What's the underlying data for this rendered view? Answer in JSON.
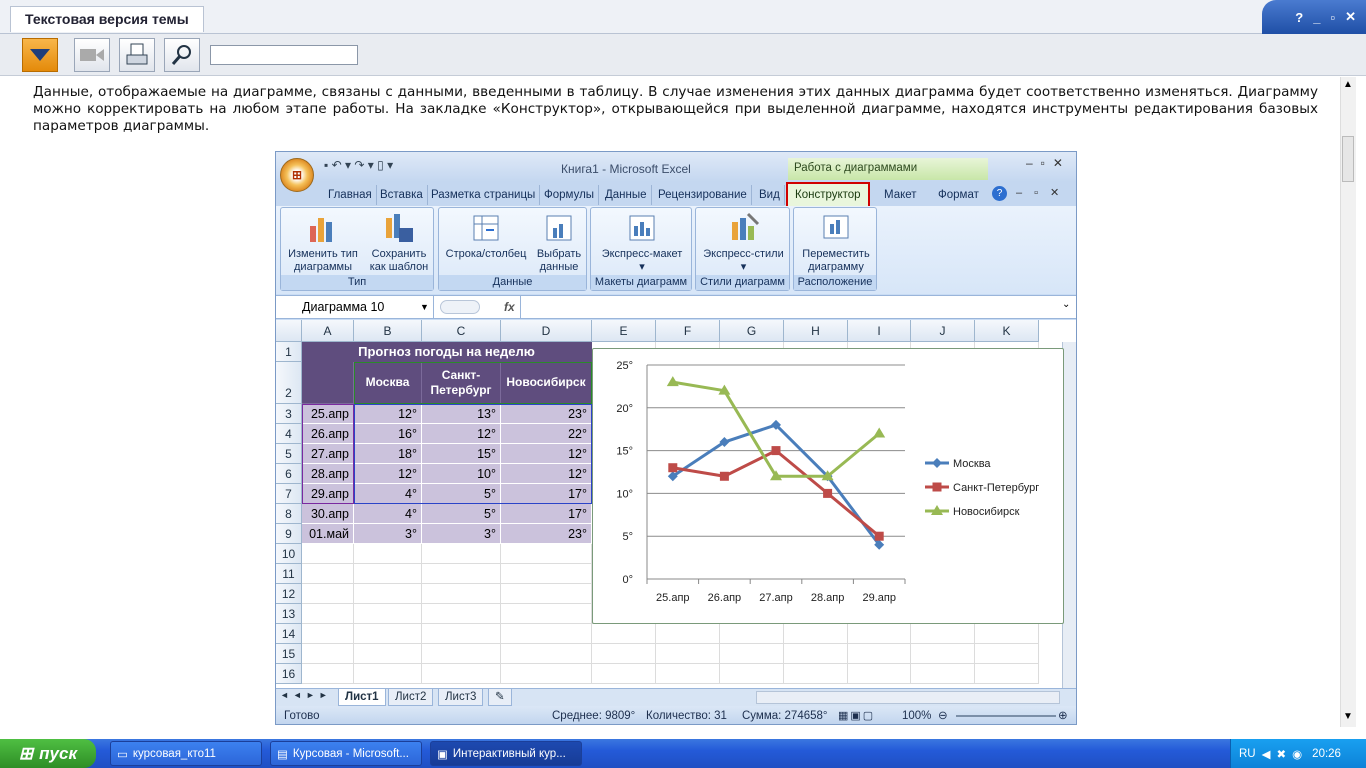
{
  "app": {
    "title_tab": "Текстовая версия темы",
    "controls": "? _ ▫ ✕"
  },
  "toolbar": {
    "search_value": ""
  },
  "content": {
    "paragraph": "Данные, отображаемые на диаграмме, связаны с данными, введенными в таблицу. В случае изменения этих данных диаграмма будет соответственно изменяться. Диаграмму можно корректировать на любом этапе работы. На закладке «Конструктор», открывающейся при выделенной диаграмме, находятся инструменты редактирования базовых параметров диаграммы."
  },
  "excel": {
    "caption": "Книга1 - Microsoft Excel",
    "chart_tools": "Работа с диаграммами",
    "tabs": [
      "Главная",
      "Вставка",
      "Разметка страницы",
      "Формулы",
      "Данные",
      "Рецензирование",
      "Вид",
      "Конструктор",
      "Макет",
      "Формат"
    ],
    "groups": {
      "type": {
        "label": "Тип",
        "btn1": "Изменить тип диаграммы",
        "btn2": "Сохранить как шаблон"
      },
      "data": {
        "label": "Данные",
        "btn1": "Строка/столбец",
        "btn2": "Выбрать данные"
      },
      "layouts": {
        "label": "Макеты диаграмм",
        "btn1": "Экспресс-макет"
      },
      "styles": {
        "label": "Стили диаграмм",
        "btn1": "Экспресс-стили"
      },
      "location": {
        "label": "Расположение",
        "btn1": "Переместить диаграмму"
      }
    },
    "name_box": "Диаграмма 10",
    "fx": "fx",
    "columns": [
      "A",
      "B",
      "C",
      "D",
      "E",
      "F",
      "G",
      "H",
      "I",
      "J",
      "K"
    ],
    "rows": [
      "1",
      "2",
      "3",
      "4",
      "5",
      "6",
      "7",
      "8",
      "9",
      "10",
      "11",
      "12",
      "13",
      "14",
      "15",
      "16"
    ],
    "table": {
      "title": "Прогноз погоды на неделю",
      "headers": [
        "Москва",
        "Санкт-Петербург",
        "Новосибирск"
      ],
      "data": [
        [
          "25.апр",
          "12°",
          "13°",
          "23°"
        ],
        [
          "26.апр",
          "16°",
          "12°",
          "22°"
        ],
        [
          "27.апр",
          "18°",
          "15°",
          "12°"
        ],
        [
          "28.апр",
          "12°",
          "10°",
          "12°"
        ],
        [
          "29.апр",
          "4°",
          "5°",
          "17°"
        ],
        [
          "30.апр",
          "4°",
          "5°",
          "17°"
        ],
        [
          "01.май",
          "3°",
          "3°",
          "23°"
        ]
      ]
    },
    "sheets": [
      "Лист1",
      "Лист2",
      "Лист3"
    ],
    "status": {
      "ready": "Готово",
      "avg": "Среднее: 9809°",
      "count": "Количество: 31",
      "sum": "Сумма: 274658°",
      "zoom": "100%"
    }
  },
  "chart_data": {
    "type": "line",
    "categories": [
      "25.апр",
      "26.апр",
      "27.апр",
      "28.апр",
      "29.апр"
    ],
    "series": [
      {
        "name": "Москва",
        "values": [
          12,
          16,
          18,
          12,
          4
        ],
        "color": "#4a7ebb",
        "marker": "diamond"
      },
      {
        "name": "Санкт-Петербург",
        "values": [
          13,
          12,
          15,
          10,
          5
        ],
        "color": "#be4b48",
        "marker": "square"
      },
      {
        "name": "Новосибирск",
        "values": [
          23,
          22,
          12,
          12,
          17
        ],
        "color": "#98b954",
        "marker": "triangle"
      }
    ],
    "ylim": [
      0,
      25
    ],
    "yticks": [
      "0°",
      "5°",
      "10°",
      "15°",
      "20°",
      "25°"
    ],
    "legend": "right",
    "grid": true
  },
  "taskbar": {
    "start": "пуск",
    "items": [
      "курсовая_кто11",
      "Курсовая - Microsoft...",
      "Интерактивный кур..."
    ],
    "lang": "RU",
    "clock": "20:26"
  }
}
